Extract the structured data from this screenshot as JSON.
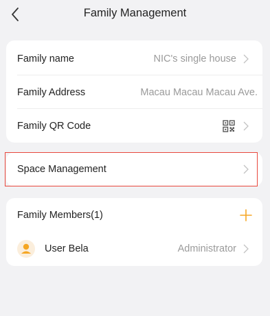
{
  "header": {
    "title": "Family Management"
  },
  "family_info": {
    "name_label": "Family name",
    "name_value": "NIC's single house",
    "address_label": "Family Address",
    "address_value": "Macau Macau Macau Ave.",
    "qr_label": "Family QR Code"
  },
  "space": {
    "label": "Space Management"
  },
  "members": {
    "header_label": "Family Members(1)",
    "items": [
      {
        "name": "User Bela",
        "role": "Administrator"
      }
    ]
  },
  "colors": {
    "accent": "#f5a623",
    "highlight": "#e8463b",
    "background": "#f2f2f4"
  },
  "icons": {
    "back": "chevron-left-icon",
    "chevron": "chevron-right-icon",
    "qr": "qr-code-icon",
    "add": "plus-icon",
    "avatar": "user-avatar-icon"
  }
}
